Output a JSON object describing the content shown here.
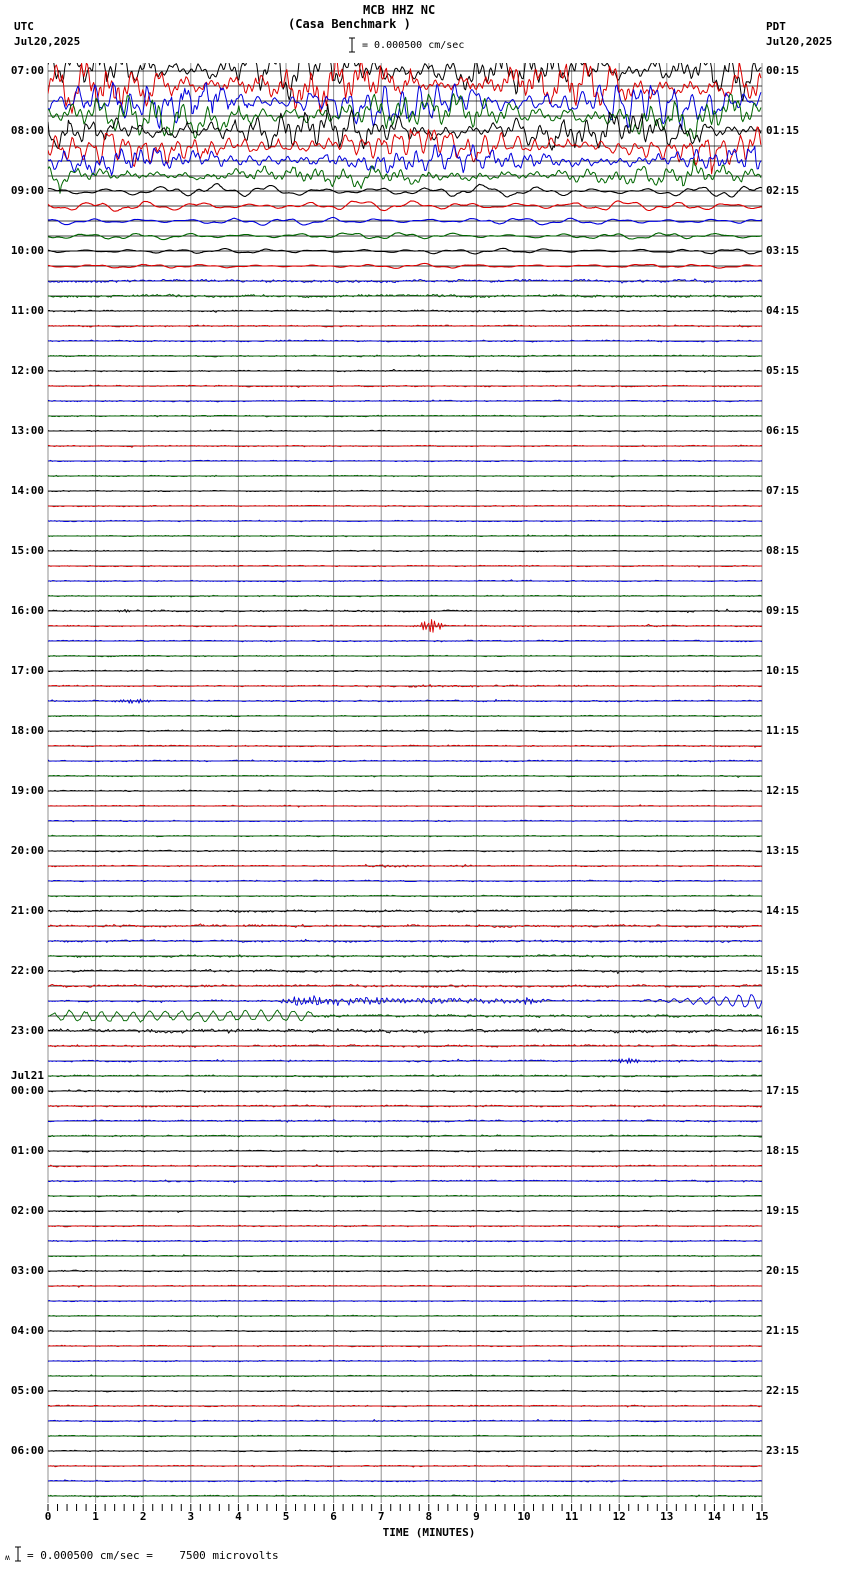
{
  "header": {
    "title": "MCB HHZ NC",
    "subtitle": "(Casa Benchmark )",
    "scale_label": "= 0.000500 cm/sec",
    "left_tz": "UTC",
    "left_date": "Jul20,2025",
    "right_tz": "PDT",
    "right_date": "Jul20,2025"
  },
  "axis": {
    "label": "TIME (MINUTES)",
    "ticks": [
      "0",
      "1",
      "2",
      "3",
      "4",
      "5",
      "6",
      "7",
      "8",
      "9",
      "10",
      "11",
      "12",
      "13",
      "14",
      "15"
    ]
  },
  "footer": {
    "prefix": "ʍ",
    "text": "= 0.000500 cm/sec =    7500 microvolts"
  },
  "palette": {
    "k": "#000000",
    "r": "#dd0000",
    "b": "#0000dd",
    "g": "#006600",
    "grid": "#909090"
  },
  "left_labels": [
    {
      "row": 0,
      "lines": [
        "07:00"
      ]
    },
    {
      "row": 4,
      "lines": [
        "08:00"
      ]
    },
    {
      "row": 8,
      "lines": [
        "09:00"
      ]
    },
    {
      "row": 12,
      "lines": [
        "10:00"
      ]
    },
    {
      "row": 16,
      "lines": [
        "11:00"
      ]
    },
    {
      "row": 20,
      "lines": [
        "12:00"
      ]
    },
    {
      "row": 24,
      "lines": [
        "13:00"
      ]
    },
    {
      "row": 28,
      "lines": [
        "14:00"
      ]
    },
    {
      "row": 32,
      "lines": [
        "15:00"
      ]
    },
    {
      "row": 36,
      "lines": [
        "16:00"
      ]
    },
    {
      "row": 40,
      "lines": [
        "17:00"
      ]
    },
    {
      "row": 44,
      "lines": [
        "18:00"
      ]
    },
    {
      "row": 48,
      "lines": [
        "19:00"
      ]
    },
    {
      "row": 52,
      "lines": [
        "20:00"
      ]
    },
    {
      "row": 56,
      "lines": [
        "21:00"
      ]
    },
    {
      "row": 60,
      "lines": [
        "22:00"
      ]
    },
    {
      "row": 64,
      "lines": [
        "23:00"
      ]
    },
    {
      "row": 68,
      "lines": [
        "Jul21",
        "00:00"
      ]
    },
    {
      "row": 72,
      "lines": [
        "01:00"
      ]
    },
    {
      "row": 76,
      "lines": [
        "02:00"
      ]
    },
    {
      "row": 80,
      "lines": [
        "03:00"
      ]
    },
    {
      "row": 84,
      "lines": [
        "04:00"
      ]
    },
    {
      "row": 88,
      "lines": [
        "05:00"
      ]
    },
    {
      "row": 92,
      "lines": [
        "06:00"
      ]
    }
  ],
  "right_labels": [
    {
      "row": 0,
      "text": "00:15"
    },
    {
      "row": 4,
      "text": "01:15"
    },
    {
      "row": 8,
      "text": "02:15"
    },
    {
      "row": 12,
      "text": "03:15"
    },
    {
      "row": 16,
      "text": "04:15"
    },
    {
      "row": 20,
      "text": "05:15"
    },
    {
      "row": 24,
      "text": "06:15"
    },
    {
      "row": 28,
      "text": "07:15"
    },
    {
      "row": 32,
      "text": "08:15"
    },
    {
      "row": 36,
      "text": "09:15"
    },
    {
      "row": 40,
      "text": "10:15"
    },
    {
      "row": 44,
      "text": "11:15"
    },
    {
      "row": 48,
      "text": "12:15"
    },
    {
      "row": 52,
      "text": "13:15"
    },
    {
      "row": 56,
      "text": "14:15"
    },
    {
      "row": 60,
      "text": "15:15"
    },
    {
      "row": 64,
      "text": "16:15"
    },
    {
      "row": 68,
      "text": "17:15"
    },
    {
      "row": 72,
      "text": "18:15"
    },
    {
      "row": 76,
      "text": "19:15"
    },
    {
      "row": 80,
      "text": "20:15"
    },
    {
      "row": 84,
      "text": "21:15"
    },
    {
      "row": 88,
      "text": "22:15"
    },
    {
      "row": 92,
      "text": "23:15"
    }
  ],
  "chart_data": {
    "type": "line",
    "title": "MCB HHZ NC (Casa Benchmark )",
    "xlabel": "TIME (MINUTES)",
    "x_range": [
      0,
      15
    ],
    "row_duration_min": 15,
    "rows_per_hour": 4,
    "color_cycle": [
      "black",
      "red",
      "blue",
      "green"
    ],
    "note": "96 helicorder trace rows, 15 min each, UTC 07:00 Jul20 through 06:45 Jul21; a=peak noise amplitude px, s: w=wild s=swell q=quiet; events in minutes",
    "rows": [
      {
        "c": "k",
        "a": 26,
        "s": "w"
      },
      {
        "c": "r",
        "a": 26,
        "s": "w"
      },
      {
        "c": "b",
        "a": 25,
        "s": "w",
        "e": [
          {
            "t": "burst",
            "m": 2.7,
            "m2": 3.4,
            "a": 13
          }
        ]
      },
      {
        "c": "g",
        "a": 24,
        "s": "w"
      },
      {
        "c": "k",
        "a": 22,
        "s": "w"
      },
      {
        "c": "r",
        "a": 19,
        "s": "w"
      },
      {
        "c": "b",
        "a": 15,
        "s": "w"
      },
      {
        "c": "g",
        "a": 12,
        "s": "w"
      },
      {
        "c": "k",
        "a": 7.5,
        "s": "s"
      },
      {
        "c": "r",
        "a": 6.5,
        "s": "s"
      },
      {
        "c": "b",
        "a": 4.5,
        "s": "s"
      },
      {
        "c": "g",
        "a": 4.2,
        "s": "s"
      },
      {
        "c": "k",
        "a": 3.2,
        "s": "s"
      },
      {
        "c": "r",
        "a": 2.6,
        "s": "s"
      },
      {
        "c": "b",
        "a": 1.7,
        "s": "q"
      },
      {
        "c": "g",
        "a": 1.7,
        "s": "q"
      },
      {
        "c": "k",
        "a": 1.1,
        "s": "q"
      },
      {
        "c": "r",
        "a": 1.0,
        "s": "q"
      },
      {
        "c": "b",
        "a": 1.0,
        "s": "q"
      },
      {
        "c": "g",
        "a": 1.0,
        "s": "q"
      },
      {
        "c": "k",
        "a": 0.9,
        "s": "q"
      },
      {
        "c": "r",
        "a": 0.9,
        "s": "q"
      },
      {
        "c": "b",
        "a": 0.9,
        "s": "q"
      },
      {
        "c": "g",
        "a": 0.9,
        "s": "q"
      },
      {
        "c": "k",
        "a": 0.8,
        "s": "q"
      },
      {
        "c": "r",
        "a": 0.8,
        "s": "q"
      },
      {
        "c": "b",
        "a": 0.8,
        "s": "q"
      },
      {
        "c": "g",
        "a": 0.8,
        "s": "q"
      },
      {
        "c": "k",
        "a": 0.8,
        "s": "q"
      },
      {
        "c": "r",
        "a": 0.8,
        "s": "q"
      },
      {
        "c": "b",
        "a": 0.8,
        "s": "q"
      },
      {
        "c": "g",
        "a": 0.8,
        "s": "q"
      },
      {
        "c": "k",
        "a": 0.8,
        "s": "q"
      },
      {
        "c": "r",
        "a": 0.8,
        "s": "q"
      },
      {
        "c": "b",
        "a": 0.8,
        "s": "q"
      },
      {
        "c": "g",
        "a": 0.8,
        "s": "q"
      },
      {
        "c": "k",
        "a": 1.1,
        "s": "q",
        "e": [
          {
            "t": "spike",
            "m": 1.6,
            "a": 1.5,
            "w": 0.15
          }
        ]
      },
      {
        "c": "r",
        "a": 0.9,
        "s": "q",
        "e": [
          {
            "t": "spike",
            "m": 8.05,
            "a": 7,
            "w": 0.22
          }
        ]
      },
      {
        "c": "b",
        "a": 0.9,
        "s": "q"
      },
      {
        "c": "g",
        "a": 0.8,
        "s": "q"
      },
      {
        "c": "k",
        "a": 0.9,
        "s": "q"
      },
      {
        "c": "r",
        "a": 0.9,
        "s": "q",
        "e": [
          {
            "t": "burst",
            "m": 7.4,
            "m2": 10.5,
            "a": 1.3
          }
        ]
      },
      {
        "c": "b",
        "a": 1.0,
        "s": "q",
        "e": [
          {
            "t": "spike",
            "m": 1.8,
            "a": 2.2,
            "w": 0.3
          }
        ]
      },
      {
        "c": "g",
        "a": 0.8,
        "s": "q"
      },
      {
        "c": "k",
        "a": 1.0,
        "s": "q"
      },
      {
        "c": "r",
        "a": 0.9,
        "s": "q"
      },
      {
        "c": "b",
        "a": 0.9,
        "s": "q"
      },
      {
        "c": "g",
        "a": 0.8,
        "s": "q"
      },
      {
        "c": "k",
        "a": 0.9,
        "s": "q"
      },
      {
        "c": "r",
        "a": 0.8,
        "s": "q"
      },
      {
        "c": "b",
        "a": 0.8,
        "s": "q"
      },
      {
        "c": "g",
        "a": 0.8,
        "s": "q"
      },
      {
        "c": "k",
        "a": 1.0,
        "s": "q"
      },
      {
        "c": "r",
        "a": 0.9,
        "s": "q",
        "e": [
          {
            "t": "burst",
            "m": 6.6,
            "m2": 8.6,
            "a": 1.6
          }
        ]
      },
      {
        "c": "b",
        "a": 0.9,
        "s": "q"
      },
      {
        "c": "g",
        "a": 0.9,
        "s": "q"
      },
      {
        "c": "k",
        "a": 1.5,
        "s": "q"
      },
      {
        "c": "r",
        "a": 1.6,
        "s": "q"
      },
      {
        "c": "b",
        "a": 1.4,
        "s": "q"
      },
      {
        "c": "g",
        "a": 1.4,
        "s": "q"
      },
      {
        "c": "k",
        "a": 1.5,
        "s": "q"
      },
      {
        "c": "r",
        "a": 1.6,
        "s": "q"
      },
      {
        "c": "b",
        "a": 1.2,
        "s": "q",
        "e": [
          {
            "t": "burst",
            "m": 4.85,
            "m2": 10,
            "a": 5.5
          },
          {
            "t": "grow",
            "m": 12.4,
            "a": 9,
            "p": 13
          }
        ]
      },
      {
        "c": "g",
        "a": 1.8,
        "s": "q",
        "e": [
          {
            "t": "osc",
            "m": 0,
            "m2": 5.6,
            "a": 5.2,
            "p": 16
          }
        ]
      },
      {
        "c": "k",
        "a": 2.2,
        "s": "q"
      },
      {
        "c": "r",
        "a": 1.4,
        "s": "q"
      },
      {
        "c": "b",
        "a": 1.1,
        "s": "q",
        "e": [
          {
            "t": "spike",
            "m": 12.2,
            "a": 2.4,
            "w": 0.35
          }
        ]
      },
      {
        "c": "g",
        "a": 1.1,
        "s": "q"
      },
      {
        "c": "k",
        "a": 1.3,
        "s": "q"
      },
      {
        "c": "r",
        "a": 1.2,
        "s": "q"
      },
      {
        "c": "b",
        "a": 1.2,
        "s": "q"
      },
      {
        "c": "g",
        "a": 1.1,
        "s": "q"
      },
      {
        "c": "k",
        "a": 1.0,
        "s": "q"
      },
      {
        "c": "r",
        "a": 1.0,
        "s": "q"
      },
      {
        "c": "b",
        "a": 1.0,
        "s": "q"
      },
      {
        "c": "g",
        "a": 0.9,
        "s": "q"
      },
      {
        "c": "k",
        "a": 0.9,
        "s": "q"
      },
      {
        "c": "r",
        "a": 0.9,
        "s": "q"
      },
      {
        "c": "b",
        "a": 0.9,
        "s": "q"
      },
      {
        "c": "g",
        "a": 0.8,
        "s": "q"
      },
      {
        "c": "k",
        "a": 0.9,
        "s": "q"
      },
      {
        "c": "r",
        "a": 0.8,
        "s": "q"
      },
      {
        "c": "b",
        "a": 0.8,
        "s": "q"
      },
      {
        "c": "g",
        "a": 0.8,
        "s": "q"
      },
      {
        "c": "k",
        "a": 0.8,
        "s": "q"
      },
      {
        "c": "r",
        "a": 0.8,
        "s": "q"
      },
      {
        "c": "b",
        "a": 0.8,
        "s": "q"
      },
      {
        "c": "g",
        "a": 0.8,
        "s": "q"
      },
      {
        "c": "k",
        "a": 0.8,
        "s": "q"
      },
      {
        "c": "r",
        "a": 0.9,
        "s": "q"
      },
      {
        "c": "b",
        "a": 0.9,
        "s": "q"
      },
      {
        "c": "g",
        "a": 0.8,
        "s": "q"
      },
      {
        "c": "k",
        "a": 0.9,
        "s": "q"
      },
      {
        "c": "r",
        "a": 0.8,
        "s": "q"
      },
      {
        "c": "b",
        "a": 0.9,
        "s": "q"
      },
      {
        "c": "g",
        "a": 0.9,
        "s": "q"
      }
    ]
  }
}
